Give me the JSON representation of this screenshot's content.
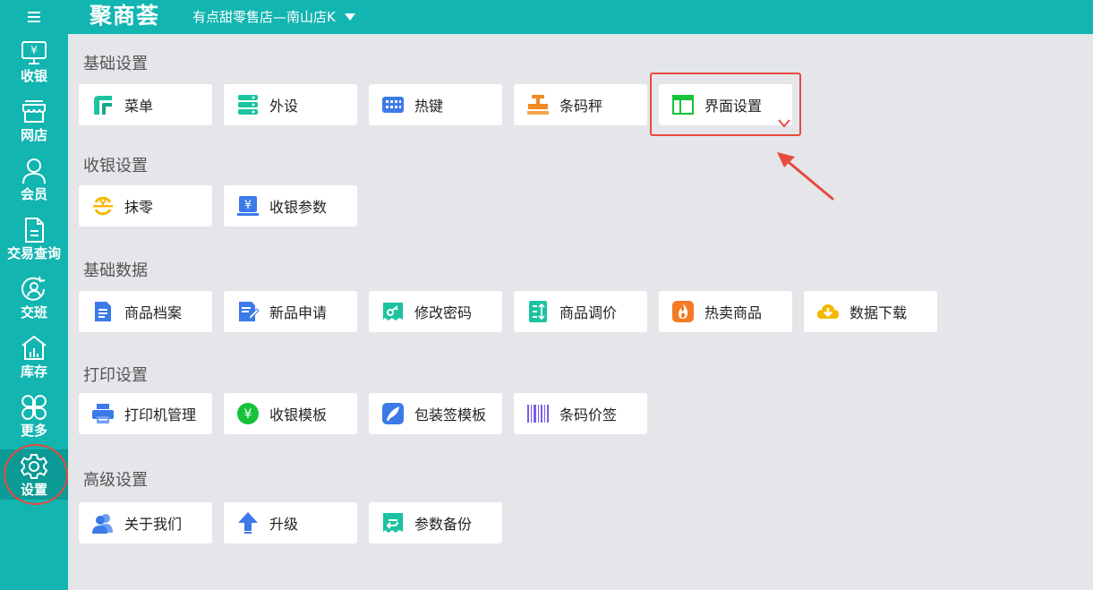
{
  "header": {
    "logo": "聚商荟",
    "store_name": "有点甜零售店—南山店K"
  },
  "sidebar": {
    "items": [
      {
        "label": "收银",
        "icon": "cashier-icon"
      },
      {
        "label": "网店",
        "icon": "shop-icon"
      },
      {
        "label": "会员",
        "icon": "member-icon"
      },
      {
        "label": "交易查询",
        "icon": "document-icon"
      },
      {
        "label": "交班",
        "icon": "handover-icon"
      },
      {
        "label": "库存",
        "icon": "warehouse-icon"
      },
      {
        "label": "更多",
        "icon": "more-icon"
      },
      {
        "label": "设置",
        "icon": "gear-icon"
      }
    ],
    "active": "设置"
  },
  "sections": [
    {
      "title": "基础设置",
      "items": [
        "菜单",
        "外设",
        "热键",
        "条码秤",
        "界面设置"
      ]
    },
    {
      "title": "收银设置",
      "items": [
        "抹零",
        "收银参数"
      ]
    },
    {
      "title": "基础数据",
      "items": [
        "商品档案",
        "新品申请",
        "修改密码",
        "商品调价",
        "热卖商品",
        "数据下载"
      ]
    },
    {
      "title": "打印设置",
      "items": [
        "打印机管理",
        "收银模板",
        "包装签模板",
        "条码价签"
      ]
    },
    {
      "title": "高级设置",
      "items": [
        "关于我们",
        "升级",
        "参数备份"
      ]
    }
  ],
  "colors": {
    "brand": "#12b5b0",
    "annotation": "#e84a3f"
  }
}
